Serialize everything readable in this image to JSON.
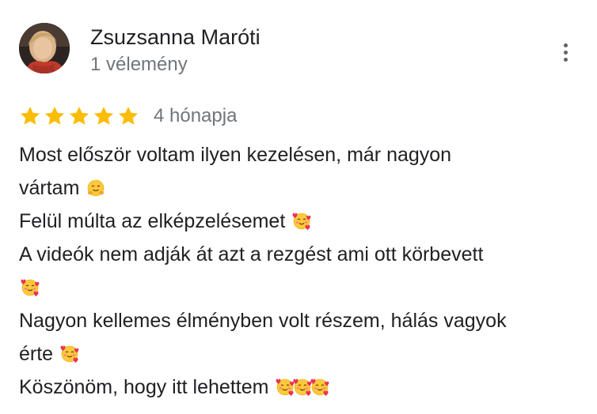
{
  "reviewer": {
    "name": "Zsuzsanna Maróti",
    "review_count": "1 vélemény",
    "avatar_icon": "profile-photo"
  },
  "menu": {
    "icon": "more-vert-icon"
  },
  "rating": {
    "stars": 5,
    "max_stars": 5,
    "star_color": "#fbbc04",
    "date": "4 hónapja"
  },
  "review": {
    "lines": [
      "Most először voltam ilyen kezelésen, már nagyon",
      "vártam",
      "Felül múlta az elképzelésemet",
      "A videók nem adják át azt a rezgést ami ott körbevett",
      "",
      "Nagyon kellemes élményben volt részem, hálás vagyok",
      "érte",
      "Köszönöm, hogy itt lehettem"
    ],
    "line_emojis": [
      [],
      [
        "hugging-face-emoji"
      ],
      [
        "smiling-face-with-hearts-emoji"
      ],
      [],
      [
        "smiling-face-with-hearts-emoji"
      ],
      [],
      [
        "smiling-face-with-hearts-emoji"
      ],
      [
        "smiling-face-with-hearts-emoji",
        "smiling-face-with-hearts-emoji",
        "smiling-face-with-hearts-emoji"
      ]
    ]
  }
}
